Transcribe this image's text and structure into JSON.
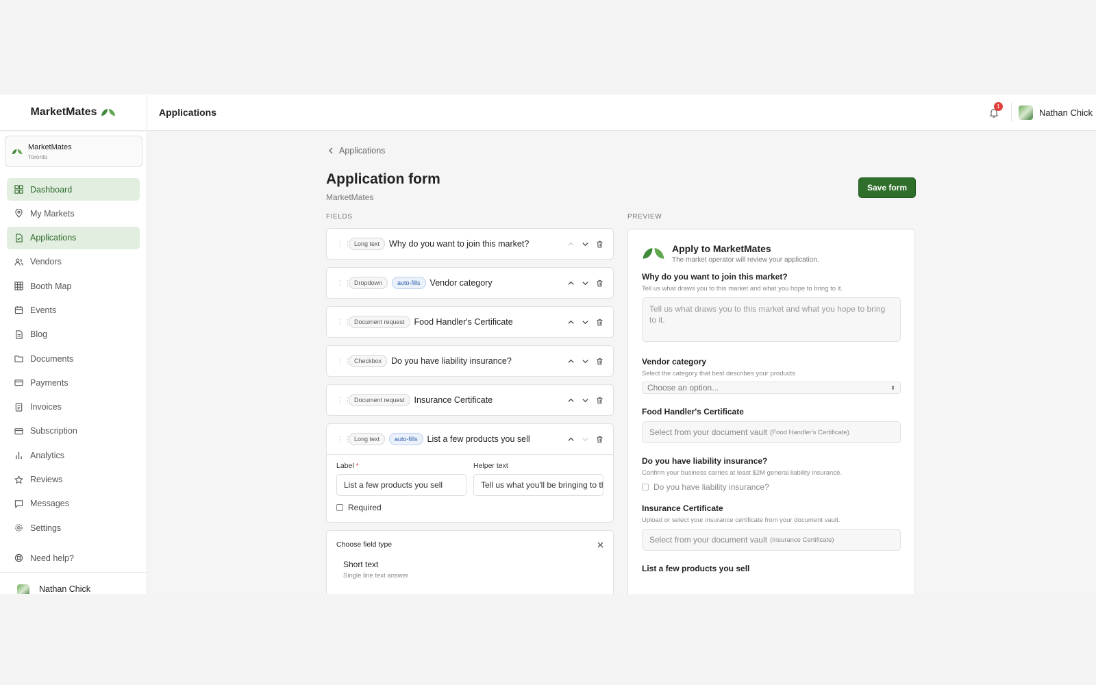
{
  "brand": {
    "name": "MarketMates"
  },
  "topbar": {
    "title": "Applications",
    "notifications": "1",
    "user_name": "Nathan Chick"
  },
  "org": {
    "name": "MarketMates",
    "city": "Toronto"
  },
  "sidebar": {
    "items": [
      {
        "label": "Dashboard",
        "icon": "dashboard-icon",
        "active": true
      },
      {
        "label": "My Markets",
        "icon": "map-pin-icon"
      },
      {
        "label": "Applications",
        "icon": "file-icon",
        "active": true
      },
      {
        "label": "Vendors",
        "icon": "users-icon"
      },
      {
        "label": "Booth Map",
        "icon": "grid-icon"
      },
      {
        "label": "Events",
        "icon": "calendar-icon"
      },
      {
        "label": "Blog",
        "icon": "document-icon"
      },
      {
        "label": "Documents",
        "icon": "folder-icon"
      },
      {
        "label": "Payments",
        "icon": "card-icon"
      },
      {
        "label": "Invoices",
        "icon": "receipt-icon"
      },
      {
        "label": "Subscription",
        "icon": "card-icon"
      },
      {
        "label": "Analytics",
        "icon": "bar-chart-icon"
      },
      {
        "label": "Reviews",
        "icon": "star-icon"
      },
      {
        "label": "Messages",
        "icon": "message-icon"
      },
      {
        "label": "Settings",
        "icon": "gear-icon"
      }
    ],
    "help": "Need help?",
    "footer_user": "Nathan Chick"
  },
  "page": {
    "breadcrumb": "Applications",
    "title": "Application form",
    "subtitle": "MarketMates",
    "save_label": "Save form",
    "fields_label": "FIELDS",
    "preview_label": "PREVIEW"
  },
  "fields": [
    {
      "type": "Long text",
      "autofill": "",
      "name": "Why do you want to join this market?"
    },
    {
      "type": "Dropdown",
      "autofill": "auto-fills",
      "name": "Vendor category"
    },
    {
      "type": "Document request",
      "autofill": "",
      "name": "Food Handler's Certificate"
    },
    {
      "type": "Checkbox",
      "autofill": "",
      "name": "Do you have liability insurance?"
    },
    {
      "type": "Document request",
      "autofill": "",
      "name": "Insurance Certificate"
    }
  ],
  "expanded_field": {
    "type": "Long text",
    "autofill": "auto-fills",
    "name": "List a few products you sell",
    "label_title": "Label",
    "label_value": "List a few products you sell",
    "helper_title": "Helper text",
    "helper_value": "Tell us what you'll be bringing to the market",
    "required_label": "Required"
  },
  "chooser": {
    "title": "Choose field type",
    "option_title": "Short text",
    "option_desc": "Single line text answer"
  },
  "preview": {
    "title": "Apply to MarketMates",
    "subtitle": "The market operator will review your application.",
    "q1": "Why do you want to join this market?",
    "q1_help": "Tell us what draws you to this market and what you hope to bring to it.",
    "q1_placeholder": "Tell us what draws you to this market and what you hope to bring to it.",
    "q2": "Vendor category",
    "q2_help": "Select the category that best describes your products",
    "q2_placeholder": "Choose an option...",
    "q3": "Food Handler's Certificate",
    "q3_vault": "Select from your document vault",
    "q3_vault_note": "(Food Handler's Certificate)",
    "q4": "Do you have liability insurance?",
    "q4_help": "Confirm your business carries at least $2M general liability insurance.",
    "q4_checkbox": "Do you have liability insurance?",
    "q5": "Insurance Certificate",
    "q5_help": "Upload or select your insurance certificate from your document vault.",
    "q5_vault": "Select from your document vault",
    "q5_vault_note": "(Insurance Certificate)",
    "q6": "List a few products you sell"
  },
  "colors": {
    "accent": "#2f6e2b",
    "active_bg": "#e2efe0",
    "badge": "#e0413c"
  }
}
